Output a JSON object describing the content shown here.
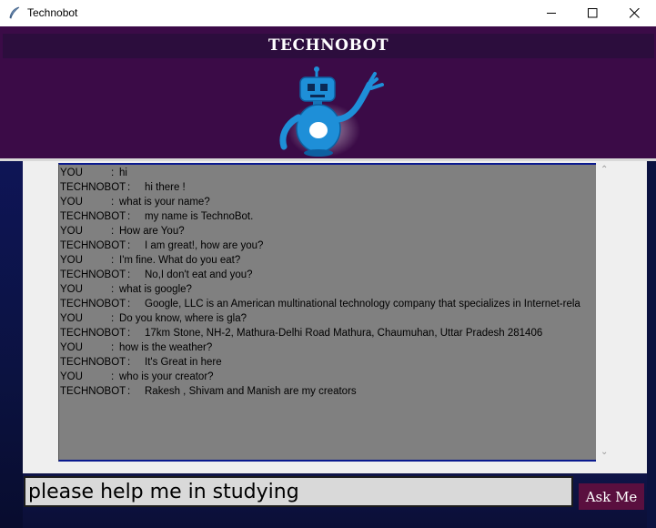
{
  "window": {
    "title": "Technobot",
    "icon": "feather-icon",
    "controls": [
      "minimize-icon",
      "maximize-icon",
      "close-icon"
    ]
  },
  "header": {
    "title": "TECHNOBOT",
    "image": "robot-mascot"
  },
  "chat": {
    "messages": [
      {
        "who": "YOU",
        "sep": ":",
        "text": "hi"
      },
      {
        "who": "TECHNOBOT",
        "sep": ":",
        "text": "hi there !"
      },
      {
        "who": "YOU",
        "sep": ":",
        "text": "what is your name?"
      },
      {
        "who": "TECHNOBOT",
        "sep": ":",
        "text": "my name is TechnoBot."
      },
      {
        "who": "YOU",
        "sep": ":",
        "text": "How are You?"
      },
      {
        "who": "TECHNOBOT",
        "sep": ":",
        "text": "I am great!, how are you?"
      },
      {
        "who": "YOU",
        "sep": ":",
        "text": "I'm fine. What do you eat?"
      },
      {
        "who": "TECHNOBOT",
        "sep": ":",
        "text": "No,I don't eat and you?"
      },
      {
        "who": "YOU",
        "sep": ":",
        "text": "what is google?"
      },
      {
        "who": "TECHNOBOT",
        "sep": ":",
        "text": "Google, LLC is an American multinational technology company that specializes in Internet-rela"
      },
      {
        "who": "YOU",
        "sep": ":",
        "text": "Do you know, where is gla?"
      },
      {
        "who": "TECHNOBOT",
        "sep": ":",
        "text": "17km Stone, NH-2, Mathura-Delhi Road Mathura, Chaumuhan, Uttar Pradesh 281406"
      },
      {
        "who": "YOU",
        "sep": ":",
        "text": "how is the weather?"
      },
      {
        "who": "TECHNOBOT",
        "sep": ":",
        "text": "It's Great in here"
      },
      {
        "who": "YOU",
        "sep": ":",
        "text": "who is your creator?"
      },
      {
        "who": "TECHNOBOT",
        "sep": ":",
        "text": "Rakesh , Shivam and Manish are my creators"
      }
    ]
  },
  "input": {
    "value": "please help me in studying"
  },
  "ask_button": {
    "label": "Ask Me"
  },
  "colors": {
    "banner": "#3b0b47",
    "chat_bg": "#808080",
    "button": "#5a0f3f",
    "side": "#0b1240"
  }
}
